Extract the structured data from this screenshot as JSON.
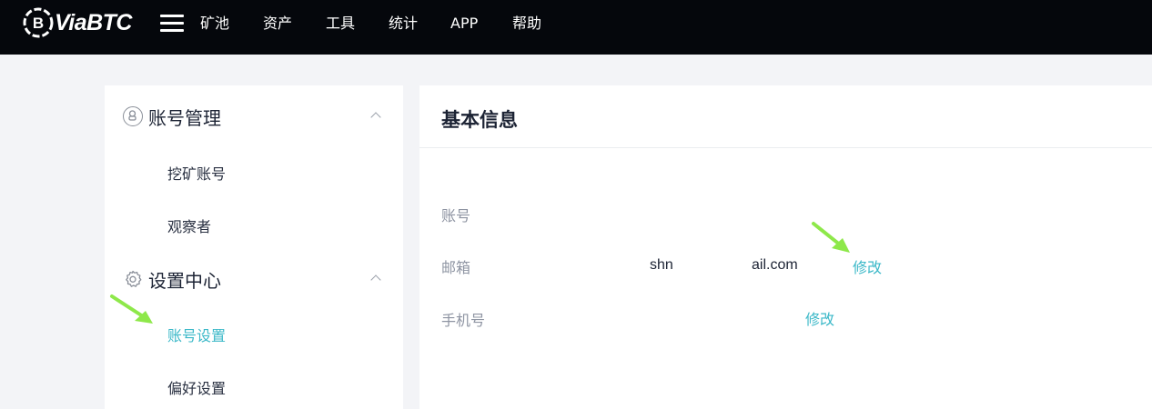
{
  "brand": {
    "name": "ViaBTC"
  },
  "nav": {
    "items": [
      {
        "label": "矿池"
      },
      {
        "label": "资产"
      },
      {
        "label": "工具"
      },
      {
        "label": "统计"
      },
      {
        "label": "APP"
      },
      {
        "label": "帮助"
      }
    ]
  },
  "sidebar": {
    "groups": [
      {
        "title": "账号管理",
        "icon": "user-circle-icon",
        "items": [
          {
            "label": "挖矿账号"
          },
          {
            "label": "观察者"
          }
        ]
      },
      {
        "title": "设置中心",
        "icon": "gear-icon",
        "items": [
          {
            "label": "账号设置",
            "active": true
          },
          {
            "label": "偏好设置"
          }
        ]
      }
    ]
  },
  "main": {
    "title": "基本信息",
    "fields": [
      {
        "label": "账号",
        "value": ""
      },
      {
        "label": "邮箱",
        "value_start": "shn",
        "value_end": "ail.com",
        "action": "修改"
      },
      {
        "label": "手机号",
        "value": "",
        "action": "修改"
      }
    ]
  },
  "colors": {
    "accent": "#3bb8c8",
    "topbar": "#05070c",
    "annotation_arrow": "#8ee84a"
  }
}
